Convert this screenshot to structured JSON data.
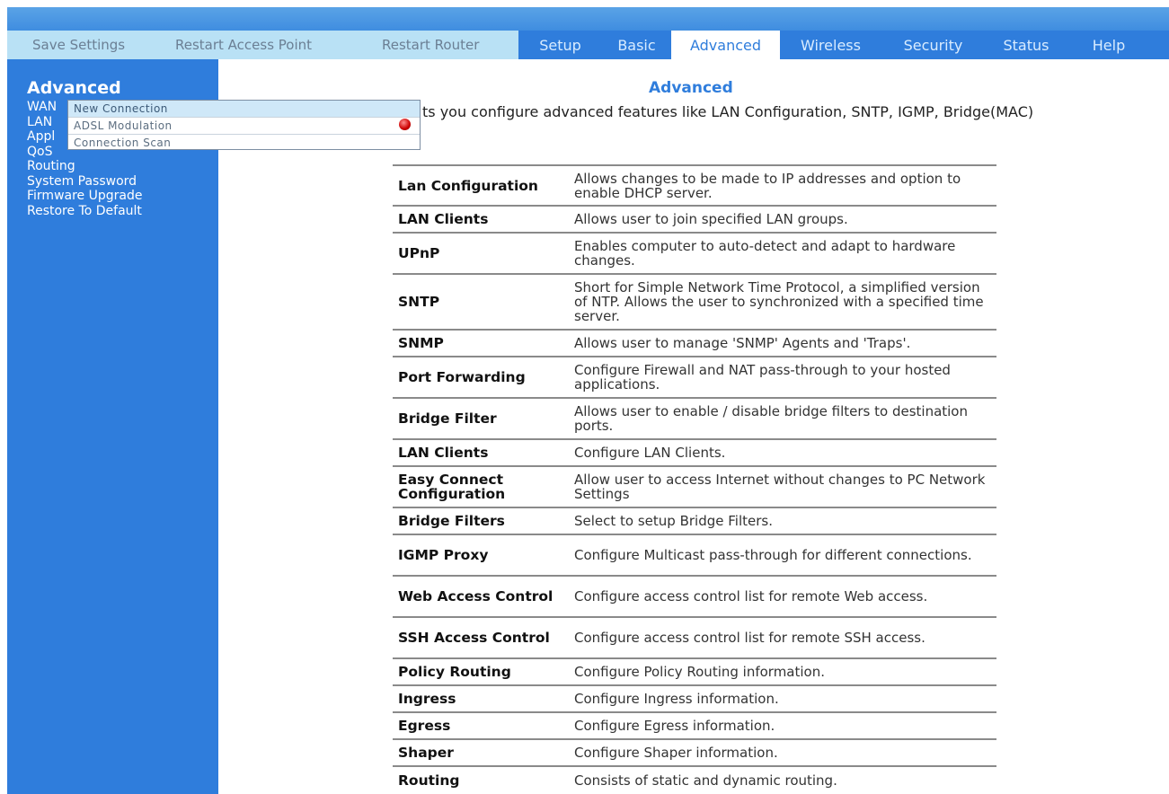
{
  "nav": {
    "links": [
      "Save Settings",
      "Restart Access Point",
      "Restart Router"
    ],
    "tabs": [
      "Setup",
      "Basic",
      "Advanced",
      "Wireless",
      "Security",
      "Status",
      "Help"
    ],
    "active_tab": "Advanced"
  },
  "sidebar": {
    "title": "Advanced",
    "items": [
      "WAN",
      "LAN",
      "Appl",
      "QoS",
      "Routing",
      "System Password",
      "Firmware Upgrade",
      "Restore To Default"
    ]
  },
  "popup": {
    "items": [
      "New Connection",
      "ADSL Modulation",
      "Connection Scan"
    ]
  },
  "main": {
    "title": "Advanced",
    "intro": "ts you configure advanced features like LAN Configuration, SNTP, IGMP, Bridge(MAC)",
    "rows": [
      {
        "name": "Lan Configuration",
        "desc": "Allows changes to be made to IP addresses and option to enable DHCP server."
      },
      {
        "name": "LAN Clients",
        "desc": "Allows user to join specified LAN groups."
      },
      {
        "name": "UPnP",
        "desc": "Enables computer to auto-detect and adapt to hardware changes."
      },
      {
        "name": "SNTP",
        "desc": "Short for Simple Network Time Protocol, a simplified version of NTP. Allows the user to synchronized with a specified time server."
      },
      {
        "name": "SNMP",
        "desc": "Allows user to manage 'SNMP' Agents and 'Traps'."
      },
      {
        "name": "Port Forwarding",
        "desc": "Configure Firewall and NAT pass-through to your hosted applications."
      },
      {
        "name": "Bridge Filter",
        "desc": "Allows user to enable / disable bridge filters to destination ports."
      },
      {
        "name": "LAN Clients",
        "desc": "Configure LAN Clients."
      },
      {
        "name": "Easy Connect Configuration",
        "desc": "Allow user to access Internet without changes to PC Network Settings"
      },
      {
        "name": "Bridge Filters",
        "desc": "Select to setup Bridge Filters."
      },
      {
        "name": "IGMP Proxy",
        "desc": "Configure Multicast pass-through for different connections."
      },
      {
        "name": "Web Access Control",
        "desc": "Configure access control list for remote Web access."
      },
      {
        "name": "SSH Access Control",
        "desc": "Configure access control list for remote SSH access."
      },
      {
        "name": "Policy Routing",
        "desc": "Configure Policy Routing information."
      },
      {
        "name": "Ingress",
        "desc": "Configure Ingress information."
      },
      {
        "name": "Egress",
        "desc": "Configure Egress information."
      },
      {
        "name": "Shaper",
        "desc": "Configure Shaper information."
      },
      {
        "name": "Routing",
        "desc": "Consists of static and dynamic routing."
      }
    ]
  },
  "colors": {
    "accent": "#2f7ddc",
    "nav_bg": "#b9e1f5",
    "alert_icon": "#cc0000"
  },
  "icons": {
    "alert": "red-dot-icon"
  }
}
